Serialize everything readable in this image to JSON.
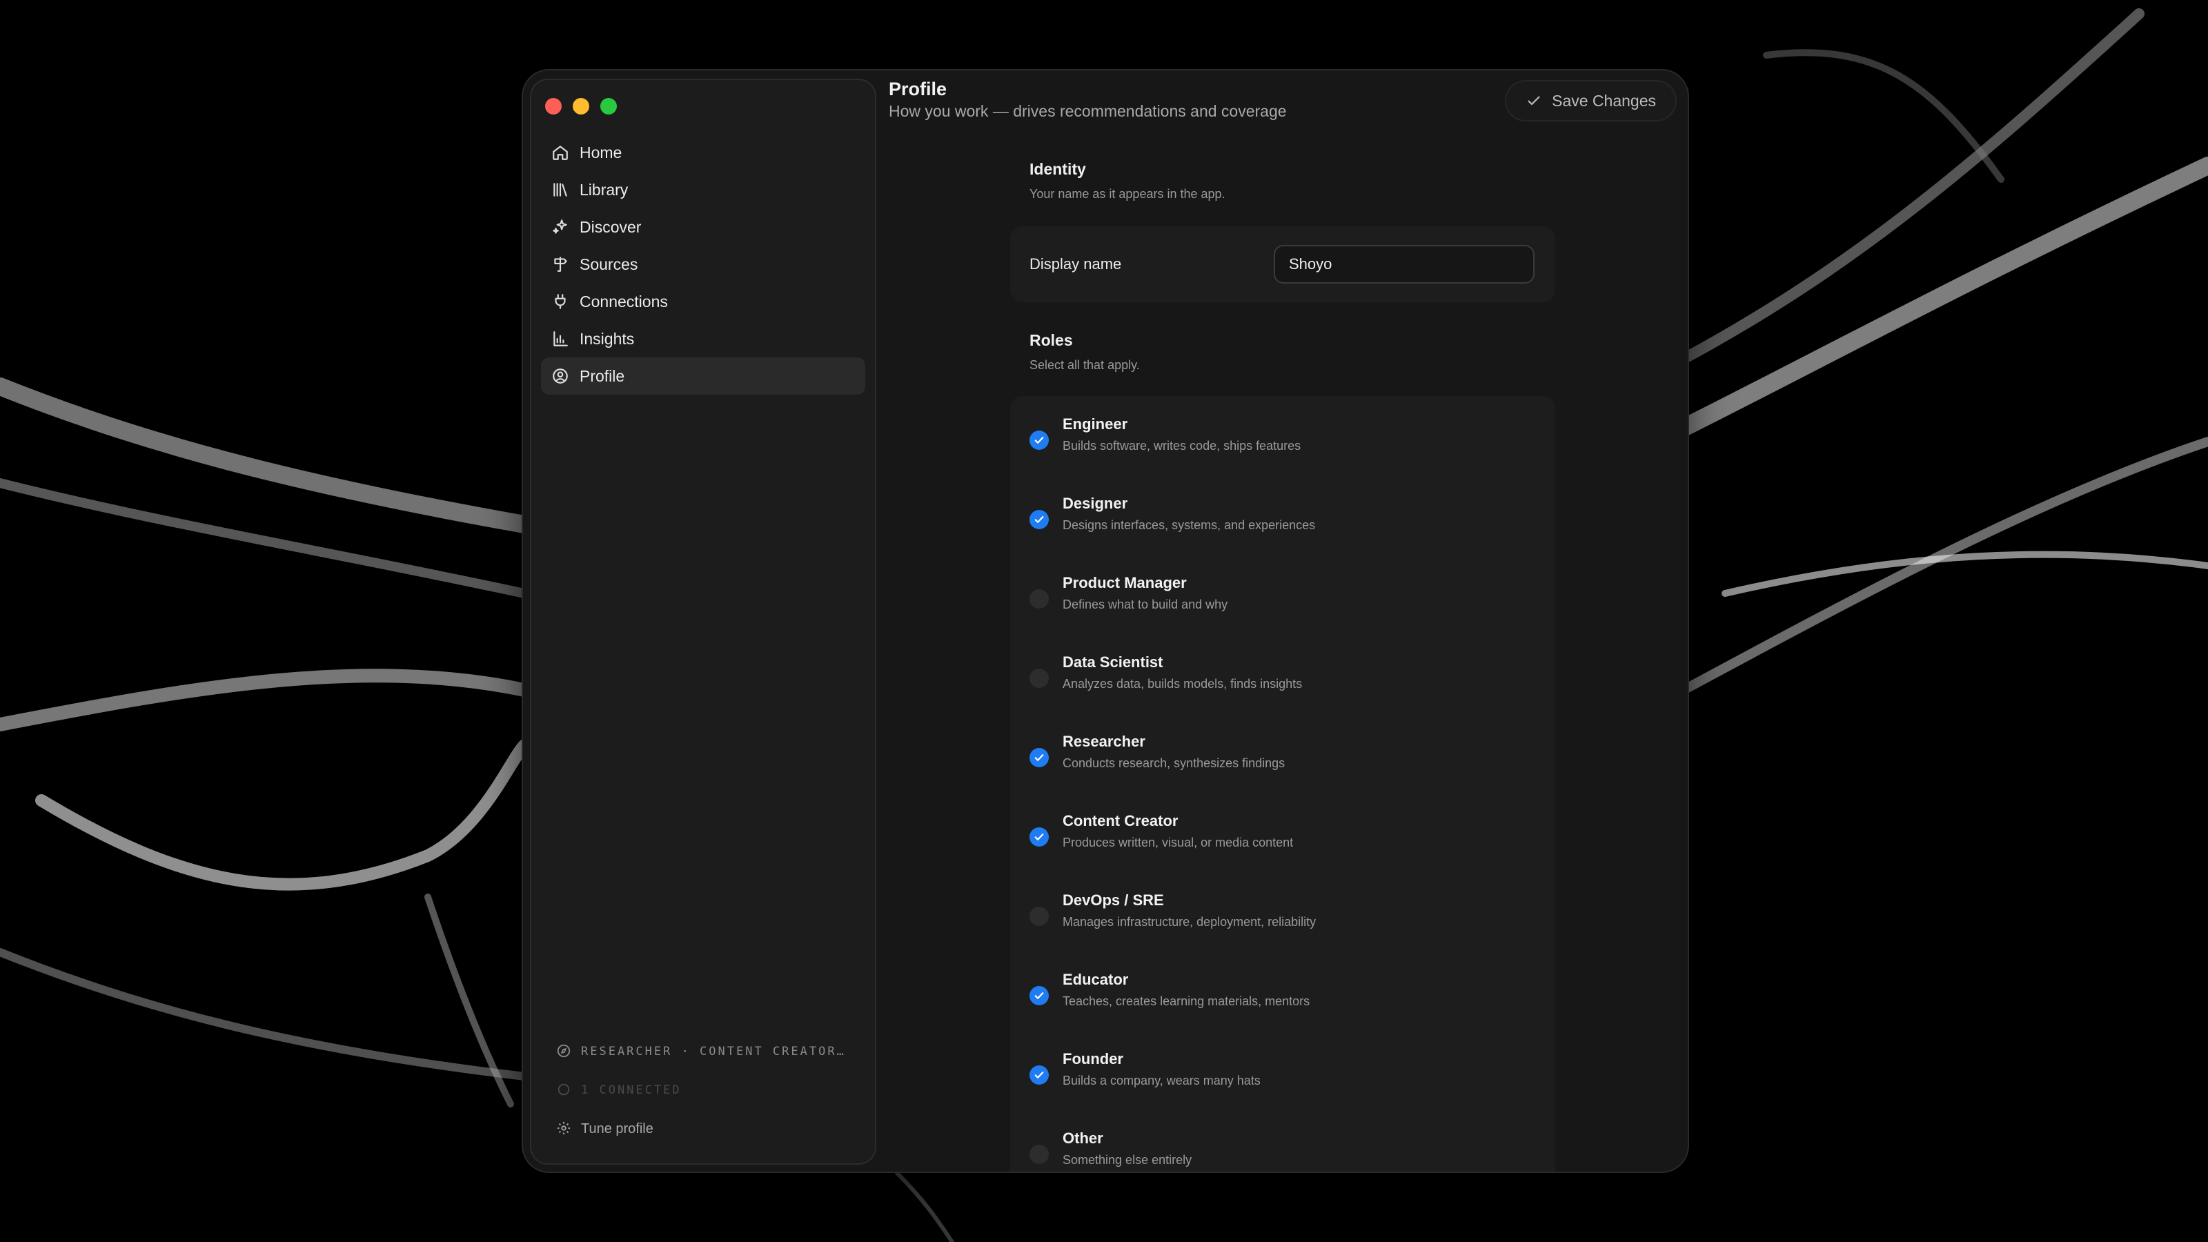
{
  "window": {
    "title": "Profile",
    "subtitle": "How you work — drives recommendations and coverage"
  },
  "toolbar": {
    "save_label": "Save Changes"
  },
  "sidebar": {
    "items": [
      {
        "label": "Home",
        "icon": "home-icon"
      },
      {
        "label": "Library",
        "icon": "library-icon"
      },
      {
        "label": "Discover",
        "icon": "sparkles-icon"
      },
      {
        "label": "Sources",
        "icon": "signpost-icon"
      },
      {
        "label": "Connections",
        "icon": "plug-icon"
      },
      {
        "label": "Insights",
        "icon": "bar-chart-icon"
      },
      {
        "label": "Profile",
        "icon": "user-circle-icon",
        "active": true
      }
    ],
    "footer": {
      "roles_summary": "RESEARCHER · CONTENT CREATOR…",
      "connected": "1 CONNECTED",
      "tune": "Tune profile"
    }
  },
  "identity": {
    "title": "Identity",
    "subtitle": "Your name as it appears in the app.",
    "display_name_label": "Display name",
    "display_name_value": "Shoyo"
  },
  "roles": {
    "title": "Roles",
    "subtitle": "Select all that apply.",
    "items": [
      {
        "name": "Engineer",
        "desc": "Builds software, writes code, ships features",
        "checked": true
      },
      {
        "name": "Designer",
        "desc": "Designs interfaces, systems, and experiences",
        "checked": true
      },
      {
        "name": "Product Manager",
        "desc": "Defines what to build and why",
        "checked": false
      },
      {
        "name": "Data Scientist",
        "desc": "Analyzes data, builds models, finds insights",
        "checked": false
      },
      {
        "name": "Researcher",
        "desc": "Conducts research, synthesizes findings",
        "checked": true
      },
      {
        "name": "Content Creator",
        "desc": "Produces written, visual, or media content",
        "checked": true
      },
      {
        "name": "DevOps / SRE",
        "desc": "Manages infrastructure, deployment, reliability",
        "checked": false
      },
      {
        "name": "Educator",
        "desc": "Teaches, creates learning materials, mentors",
        "checked": true
      },
      {
        "name": "Founder",
        "desc": "Builds a company, wears many hats",
        "checked": true
      },
      {
        "name": "Other",
        "desc": "Something else entirely",
        "checked": false
      }
    ]
  },
  "colors": {
    "accent": "#1f7cf2",
    "window_bg": "#171717",
    "sidebar_bg": "#1c1c1c"
  }
}
